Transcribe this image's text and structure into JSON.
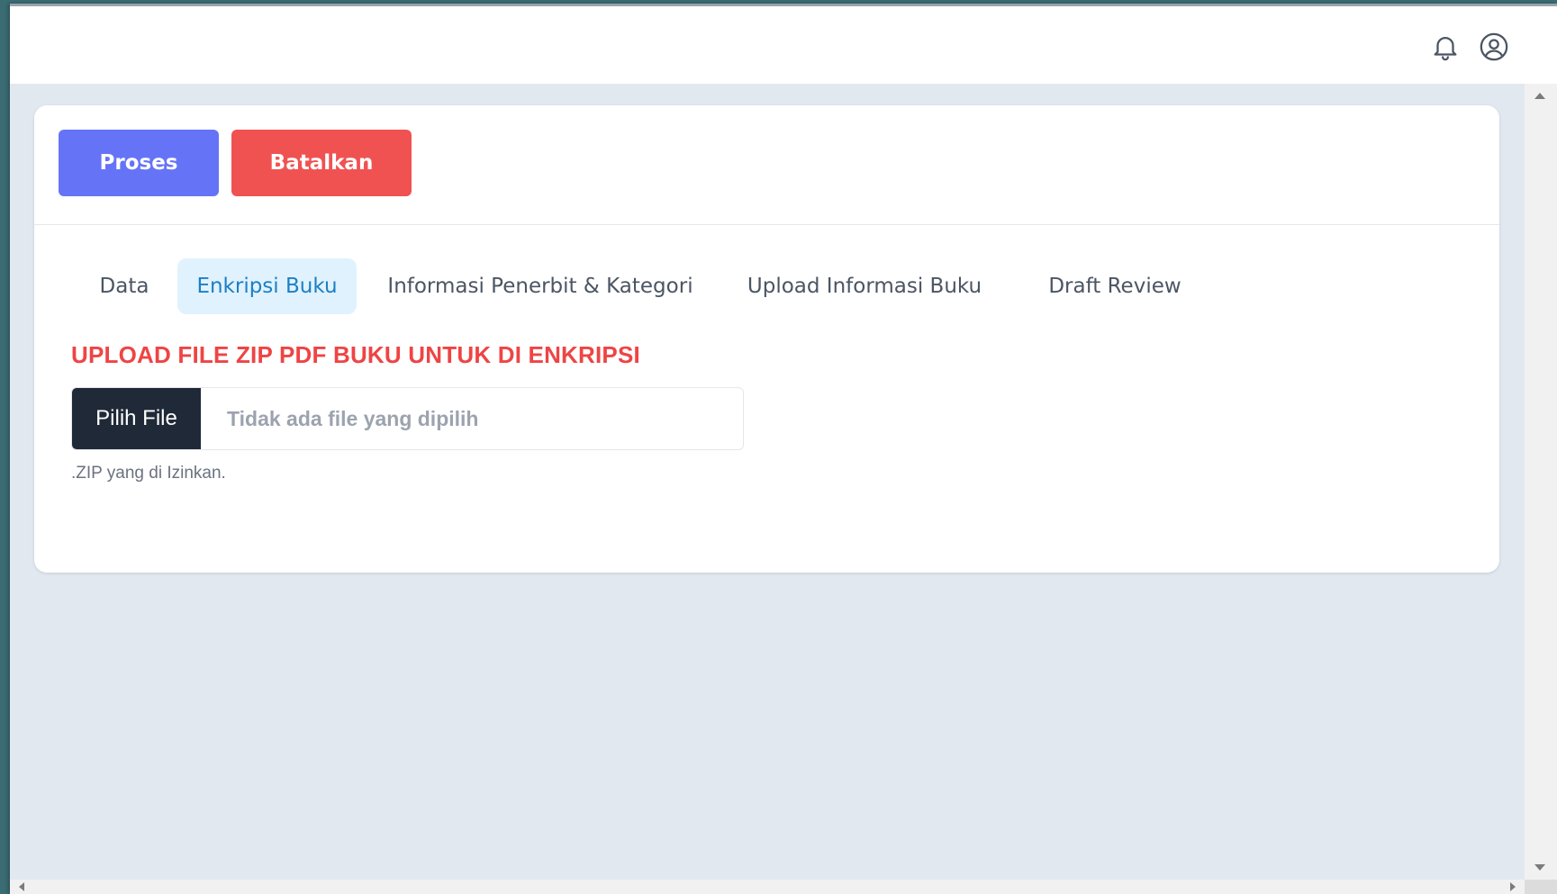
{
  "header": {
    "icons": [
      "bell-icon",
      "user-circle-icon"
    ]
  },
  "actions": {
    "proses_label": "Proses",
    "batalkan_label": "Batalkan",
    "colors": {
      "proses": "#6574f7",
      "batalkan": "#f05252"
    }
  },
  "tabs": [
    {
      "label": "Data",
      "active": false
    },
    {
      "label": "Enkripsi Buku",
      "active": true
    },
    {
      "label": "Informasi Penerbit & Kategori",
      "active": false
    },
    {
      "label": "Upload Informasi Buku",
      "active": false
    },
    {
      "label": "Draft Review",
      "active": false
    }
  ],
  "upload": {
    "title": "UPLOAD FILE ZIP PDF BUKU UNTUK DI ENKRIPSI",
    "button_label": "Pilih File",
    "status_text": "Tidak ada file yang dipilih",
    "help_text": ".ZIP yang di Izinkan.",
    "title_color": "#ef4444"
  }
}
